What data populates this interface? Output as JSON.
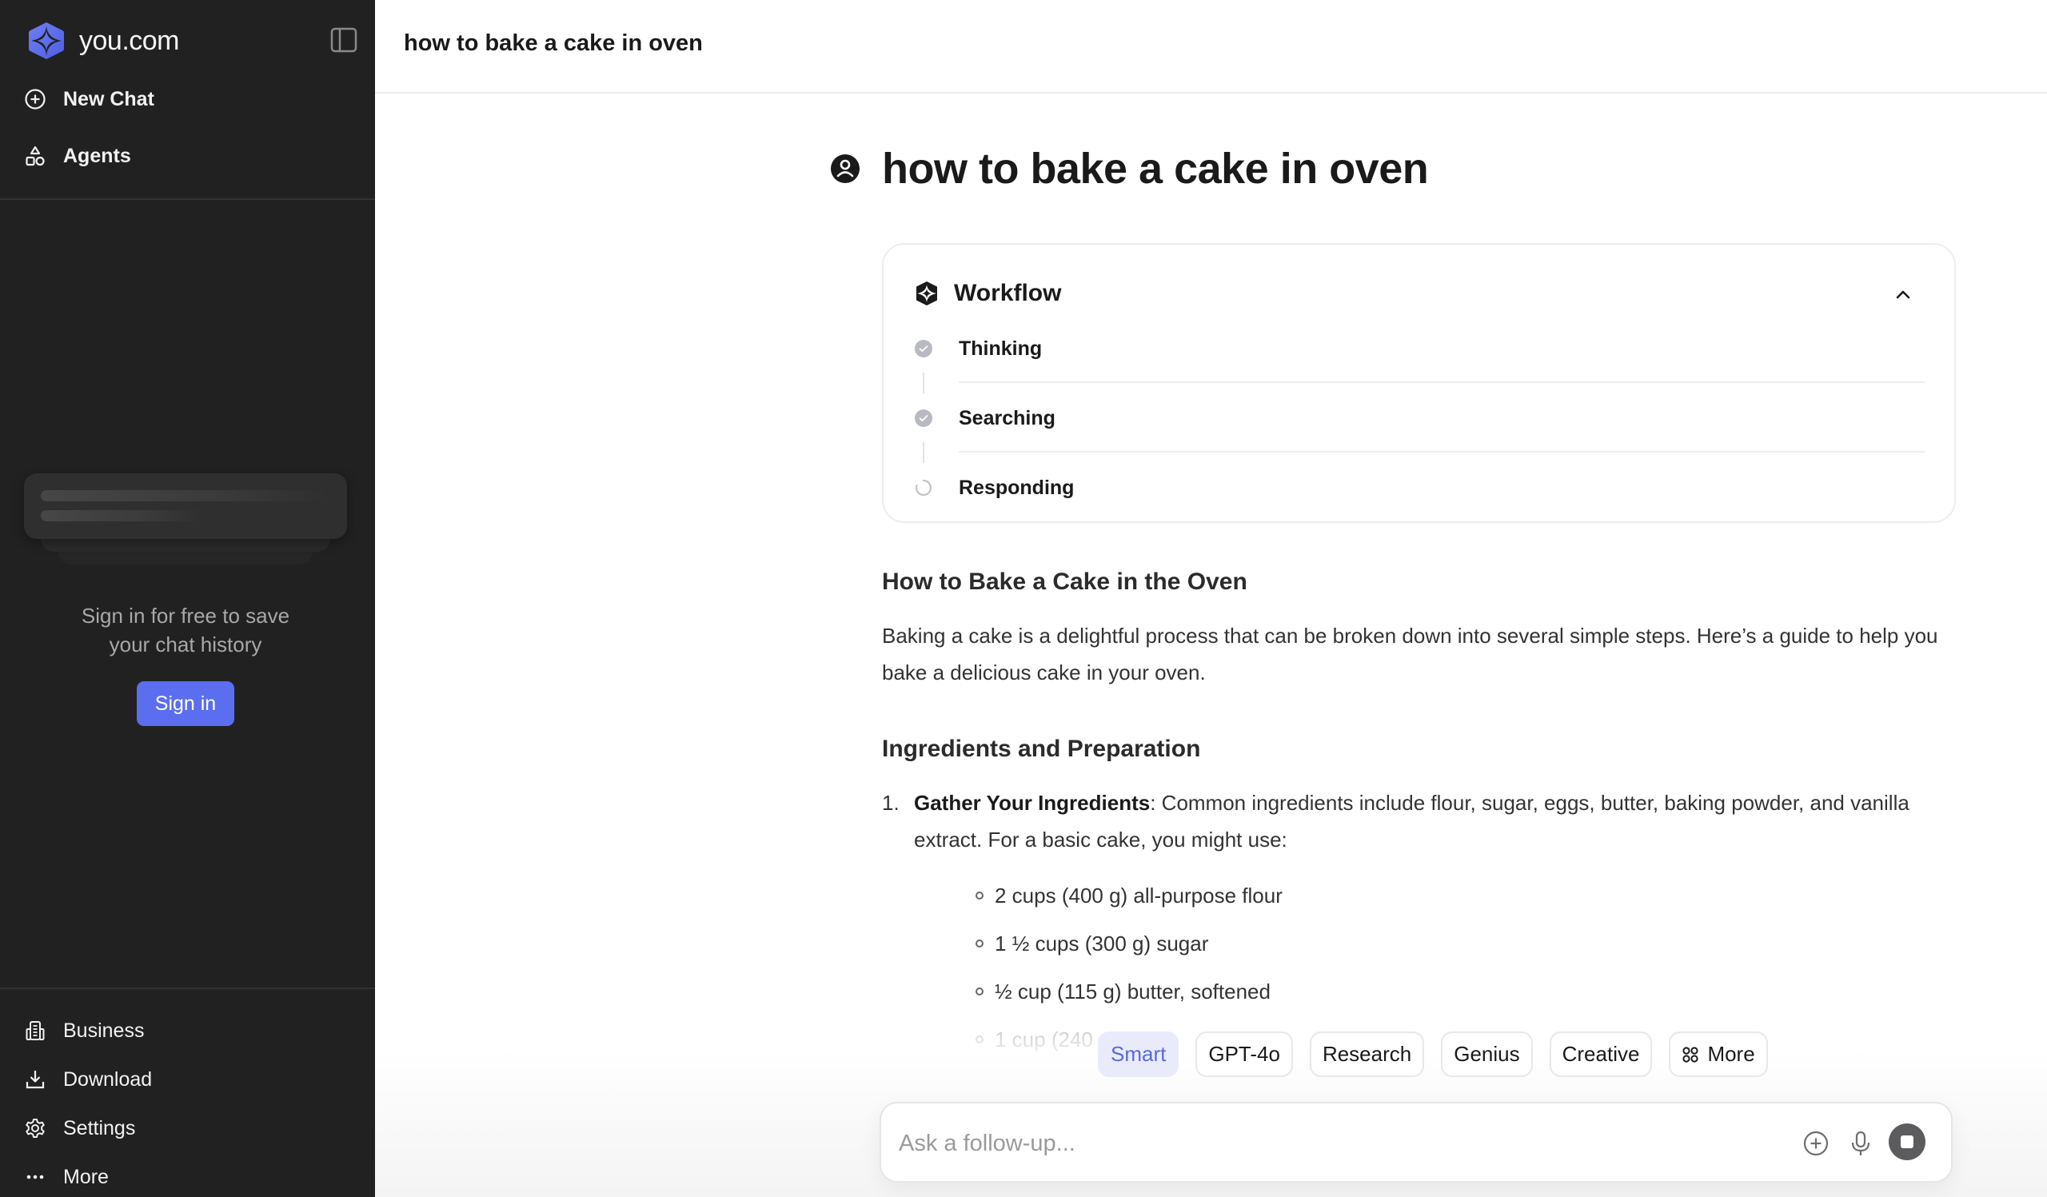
{
  "app": {
    "brand": "you.com",
    "brand_color": "#5b6ef0"
  },
  "sidebar": {
    "top_items": [
      {
        "label": "New Chat",
        "icon": "plus-circle-icon"
      },
      {
        "label": "Agents",
        "icon": "shapes-icon"
      }
    ],
    "signin_prompt": "Sign in for free to save your chat history",
    "signin_prompt_line1": "Sign in for free to save",
    "signin_prompt_line2": "your chat history",
    "signin_button": "Sign in",
    "bottom_items": [
      {
        "label": "Business",
        "icon": "building-icon"
      },
      {
        "label": "Download",
        "icon": "download-icon"
      },
      {
        "label": "Settings",
        "icon": "gear-icon"
      },
      {
        "label": "More",
        "icon": "ellipsis-icon"
      }
    ]
  },
  "header": {
    "title": "how to bake a cake in oven"
  },
  "question": {
    "text": "how to bake a cake in oven"
  },
  "workflow": {
    "title": "Workflow",
    "expanded": true,
    "steps": [
      {
        "label": "Thinking",
        "status": "done"
      },
      {
        "label": "Searching",
        "status": "done"
      },
      {
        "label": "Responding",
        "status": "in-progress"
      }
    ]
  },
  "answer": {
    "heading": "How to Bake a Cake in the Oven",
    "intro_line1": "Baking a cake is a delightful process that can be broken down into several simple steps. Here’s a guide to help you",
    "intro_line2": "bake a delicious cake in your oven.",
    "section_heading": "Ingredients and Preparation",
    "steps": [
      {
        "number": "1.",
        "title": "Gather Your Ingredients",
        "text_line1": ": Common ingredients include flour, sugar, eggs, butter, baking powder, and vanilla",
        "text_line2": "extract. For a basic cake, you might use:",
        "items": [
          "2 cups (400 g) all-purpose flour",
          "1 ½ cups (300 g) sugar",
          "½ cup (115 g) butter, softened",
          "1 cup (240"
        ]
      }
    ]
  },
  "modes": {
    "selected": "Smart",
    "options": [
      "Smart",
      "GPT-4o",
      "Research",
      "Genius",
      "Creative",
      "More"
    ]
  },
  "composer": {
    "placeholder": "Ask a follow-up...",
    "value": ""
  }
}
